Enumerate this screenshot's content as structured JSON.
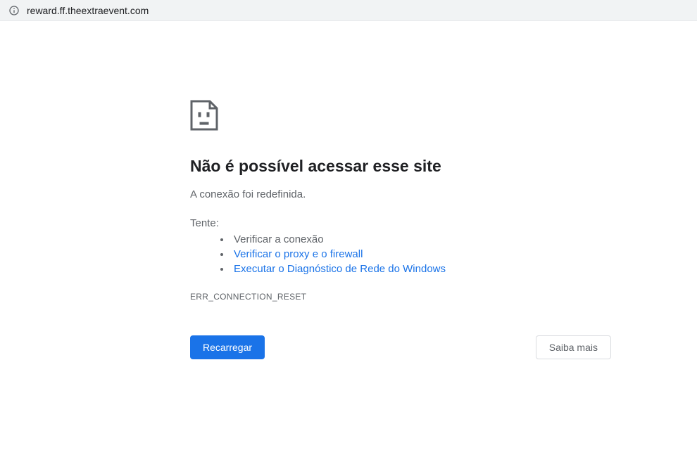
{
  "addressBar": {
    "url": "reward.ff.theextraevent.com"
  },
  "error": {
    "title": "Não é possível acessar esse site",
    "subtitle": "A conexão foi redefinida.",
    "tryLabel": "Tente:",
    "suggestions": [
      {
        "text": "Verificar a conexão",
        "isLink": false
      },
      {
        "text": "Verificar o proxy e o firewall",
        "isLink": true
      },
      {
        "text": "Executar o Diagnóstico de Rede do Windows",
        "isLink": true
      }
    ],
    "errorCode": "ERR_CONNECTION_RESET"
  },
  "buttons": {
    "reload": "Recarregar",
    "learnMore": "Saiba mais"
  }
}
